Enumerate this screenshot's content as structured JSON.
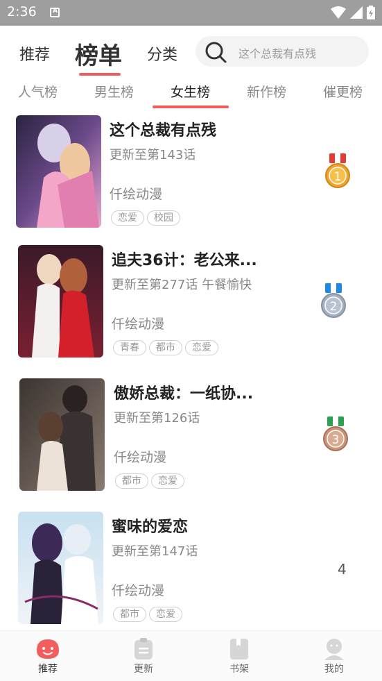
{
  "status_bar": {
    "time": "2:36",
    "notification_icon": "A"
  },
  "top_nav": {
    "tabs": [
      {
        "label": "推荐"
      },
      {
        "label": "榜单"
      },
      {
        "label": "分类"
      }
    ],
    "active_tab": "榜单",
    "search_placeholder": "这个总裁有点残"
  },
  "sub_tabs": {
    "items": [
      "人气榜",
      "男生榜",
      "女生榜",
      "新作榜",
      "催更榜"
    ],
    "active": "女生榜"
  },
  "list": [
    {
      "title": "这个总裁有点残",
      "update": "更新至第143话",
      "author": "仟绘动漫",
      "tags": [
        "恋爱",
        "校园"
      ],
      "rank": "1",
      "medal_color": "#f0a32e"
    },
    {
      "title": "追夫36计：老公来...",
      "update": "更新至第277话 午餐愉快",
      "author": "仟绘动漫",
      "tags": [
        "青春",
        "都市",
        "恋爱"
      ],
      "rank": "2",
      "medal_color": "#a3aebf"
    },
    {
      "title": "傲娇总裁：一纸协...",
      "update": "更新至第126话",
      "author": "仟绘动漫",
      "tags": [
        "都市",
        "恋爱"
      ],
      "rank": "3",
      "medal_color": "#c8957a"
    },
    {
      "title": "蜜味的爱恋",
      "update": "更新至第147话",
      "author": "仟绘动漫",
      "tags": [
        "都市",
        "恋爱"
      ],
      "rank": "4"
    }
  ],
  "bottom_nav": [
    {
      "label": "推荐",
      "icon": "smiley-icon",
      "active": true
    },
    {
      "label": "更新",
      "icon": "clipboard-icon",
      "active": false
    },
    {
      "label": "书架",
      "icon": "book-icon",
      "active": false
    },
    {
      "label": "我的",
      "icon": "user-icon",
      "active": false
    }
  ],
  "colors": {
    "accent": "#f15c5c",
    "status_bar": "#9e9e9e"
  }
}
